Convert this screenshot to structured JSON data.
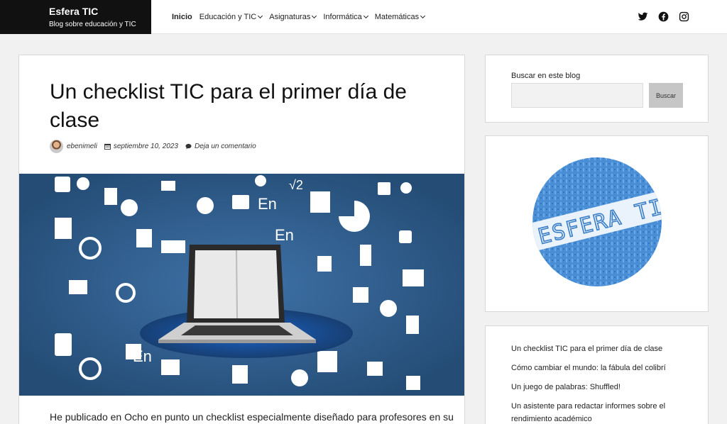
{
  "site": {
    "title": "Esfera TIC",
    "tagline": "Blog sobre educación y TIC"
  },
  "nav": {
    "items": [
      {
        "label": "Inicio",
        "active": true,
        "dropdown": false
      },
      {
        "label": "Educación y TIC",
        "active": false,
        "dropdown": true
      },
      {
        "label": "Asignaturas",
        "active": false,
        "dropdown": true
      },
      {
        "label": "Informática",
        "active": false,
        "dropdown": true
      },
      {
        "label": "Matemáticas",
        "active": false,
        "dropdown": true
      }
    ]
  },
  "social": [
    "twitter-icon",
    "facebook-icon",
    "instagram-icon"
  ],
  "article": {
    "title": "Un checklist TIC para el primer día de clase",
    "author": "ebenimeli",
    "date": "septiembre 10, 2023",
    "comments_link": "Deja un comentario",
    "excerpt": "He publicado en Ocho en punto un checklist especialmente diseñado para profesores en su",
    "hero_labels": {
      "en": "En",
      "sqrt": "√2"
    }
  },
  "sidebar": {
    "search": {
      "label": "Buscar en este blog",
      "placeholder": "",
      "button": "Buscar"
    },
    "logo_text": "ESFERA TIC",
    "recent_posts": [
      "Un checklist TIC para el primer día de clase",
      "Cómo cambiar el mundo: la fábula del colibrí",
      "Un juego de palabras: Shuffled!",
      "Un asistente para redactar informes sobre el rendimiento académico"
    ]
  },
  "colors": {
    "header_dark": "#111111",
    "hero_blue": "#2d5a86",
    "logo_blue": "#4a90d9"
  }
}
